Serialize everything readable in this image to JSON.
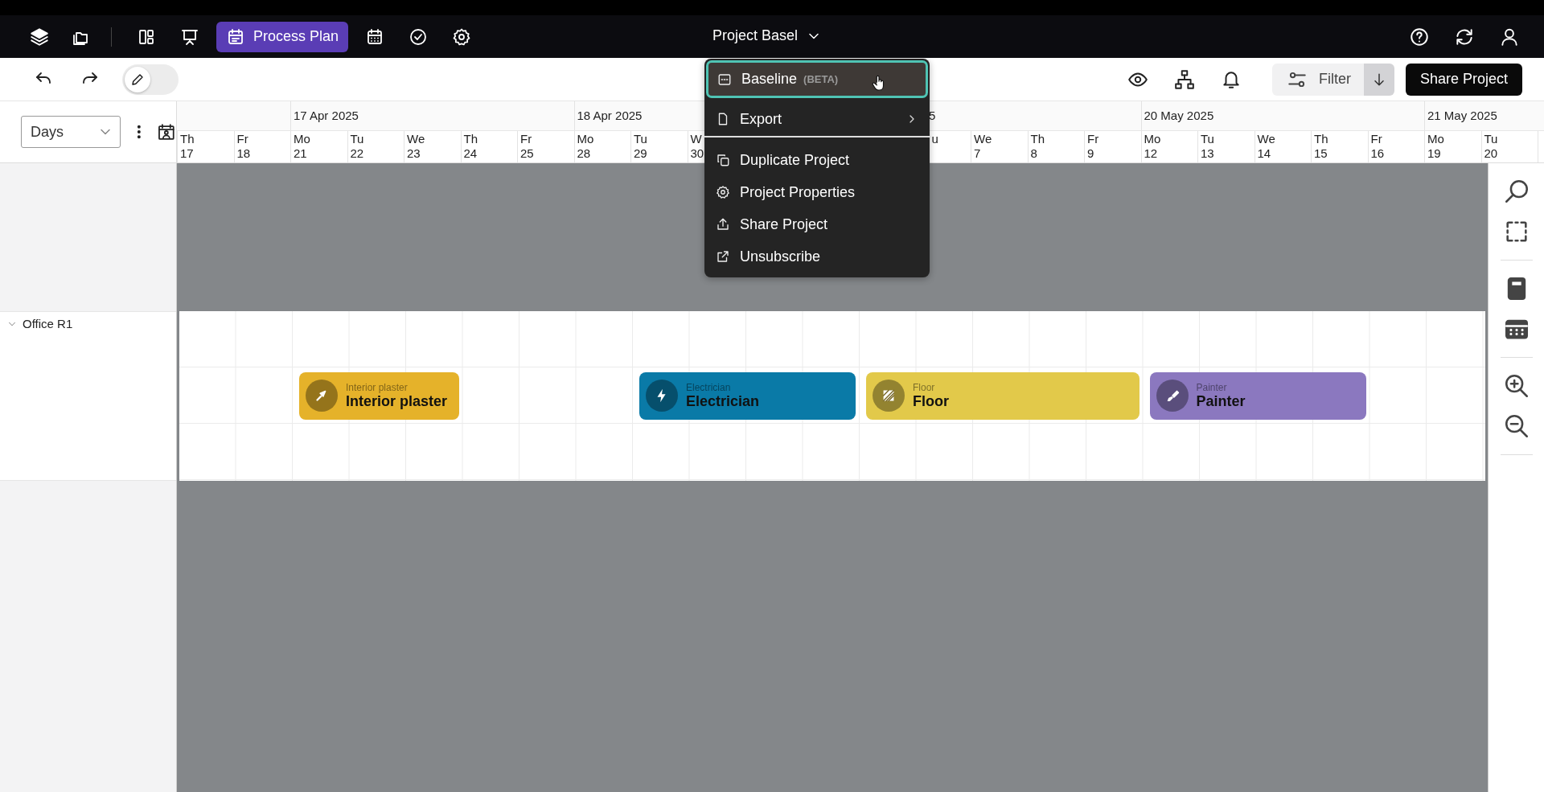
{
  "nav": {
    "tabs": [
      {
        "selected": false
      },
      {
        "selected": false
      },
      {
        "label": "Process Plan",
        "selected": true
      },
      {
        "selected": false
      },
      {
        "selected": false
      },
      {
        "selected": false
      }
    ],
    "project_title": "Project Basel"
  },
  "toolbar": {
    "edit_mode": {
      "on": false
    },
    "filter": {
      "label": "Filter"
    },
    "share_button": "Share Project"
  },
  "view_select": {
    "value": "Days"
  },
  "timeline": {
    "weeks": [
      {
        "days": [
          {
            "kind": "day",
            "dow": "Th",
            "day": "17"
          },
          {
            "kind": "day",
            "dow": "Fr",
            "day": "18"
          }
        ]
      },
      {
        "label": "17 Apr 2025",
        "days": [
          {
            "kind": "day",
            "dow": "Mo",
            "day": "21"
          },
          {
            "kind": "day",
            "dow": "Tu",
            "day": "22"
          },
          {
            "kind": "day",
            "dow": "We",
            "day": "23"
          },
          {
            "kind": "day",
            "dow": "Th",
            "day": "24"
          },
          {
            "kind": "day",
            "dow": "Fr",
            "day": "25"
          }
        ]
      },
      {
        "label": "18 Apr 2025",
        "days": [
          {
            "kind": "day",
            "dow": "Mo",
            "day": "28"
          },
          {
            "kind": "day",
            "dow": "Tu",
            "day": "29"
          },
          {
            "kind": "day",
            "dow": "W",
            "day": "30"
          },
          {
            "kind": "blank"
          },
          {
            "kind": "blank"
          }
        ]
      },
      {
        "label": "5",
        "kind": "partial",
        "days": [
          {
            "kind": "blank"
          },
          {
            "kind": "partial",
            "dow": "u"
          },
          {
            "kind": "day",
            "dow": "We",
            "day": "7"
          },
          {
            "kind": "day",
            "dow": "Th",
            "day": "8"
          },
          {
            "kind": "day",
            "dow": "Fr",
            "day": "9"
          }
        ]
      },
      {
        "label": "20 May 2025",
        "days": [
          {
            "kind": "day",
            "dow": "Mo",
            "day": "12"
          },
          {
            "kind": "day",
            "dow": "Tu",
            "day": "13"
          },
          {
            "kind": "day",
            "dow": "We",
            "day": "14"
          },
          {
            "kind": "day",
            "dow": "Th",
            "day": "15"
          },
          {
            "kind": "day",
            "dow": "Fr",
            "day": "16"
          }
        ]
      },
      {
        "label": "21 May 2025",
        "days": [
          {
            "kind": "day",
            "dow": "Mo",
            "day": "19"
          },
          {
            "kind": "day",
            "dow": "Tu",
            "day": "20"
          },
          {
            "kind": "blank"
          }
        ]
      }
    ]
  },
  "groups": [
    {
      "name": "Office R1",
      "expanded": true,
      "tasks": [
        {
          "caption": "Interior plaster",
          "title": "Interior plaster",
          "color": "#e5b22a"
        },
        {
          "caption": "Electrician",
          "title": "Electrician",
          "color": "#0a7aa7"
        },
        {
          "caption": "Floor",
          "title": "Floor",
          "color": "#e2c94a"
        },
        {
          "caption": "Painter",
          "title": "Painter",
          "color": "#8b78bf"
        }
      ]
    }
  ],
  "menu": {
    "sections": [
      {
        "items": [
          {
            "label": "Baseline",
            "badge": "(BETA)",
            "highlighted": true,
            "submenu": false
          },
          {
            "label": "Export",
            "highlighted": false,
            "submenu": true
          }
        ]
      },
      {
        "items": [
          {
            "label": "Duplicate Project",
            "highlighted": false,
            "submenu": false
          },
          {
            "label": "Project Properties",
            "highlighted": false,
            "submenu": false
          },
          {
            "label": "Share Project",
            "highlighted": false,
            "submenu": false
          },
          {
            "label": "Unsubscribe",
            "highlighted": false,
            "submenu": false
          }
        ]
      }
    ]
  }
}
